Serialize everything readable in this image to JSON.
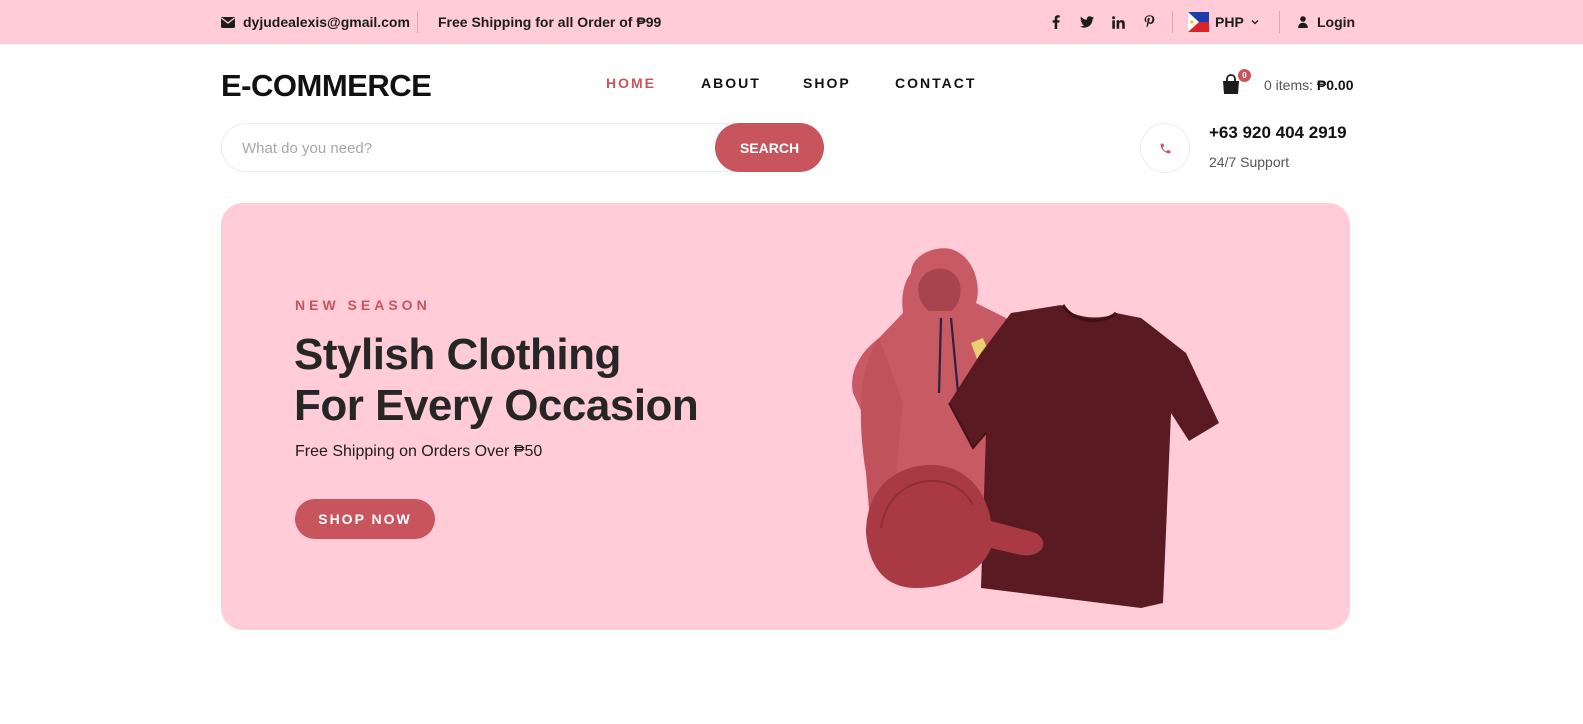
{
  "topbar": {
    "email": "dyjudealexis@gmail.com",
    "shipping_notice": "Free Shipping for all Order of ₱99",
    "social": [
      "facebook-icon",
      "twitter-icon",
      "linkedin-icon",
      "pinterest-icon"
    ],
    "currency": "PHP",
    "login_label": "Login"
  },
  "header": {
    "logo": "E-COMMERCE",
    "nav": [
      {
        "label": "HOME",
        "active": true
      },
      {
        "label": "ABOUT",
        "active": false
      },
      {
        "label": "SHOP",
        "active": false
      },
      {
        "label": "CONTACT",
        "active": false
      }
    ],
    "cart_count": "0",
    "cart_items_label": "0 items:",
    "cart_total": "₱0.00"
  },
  "search": {
    "placeholder": "What do you need?",
    "value": "",
    "button_label": "SEARCH"
  },
  "contact": {
    "phone": "+63 920 404 2919",
    "support_label": "24/7 Support"
  },
  "hero": {
    "eyebrow": "NEW SEASON",
    "title_line1": "Stylish Clothing",
    "title_line2": "For Every Occasion",
    "subtitle": "Free Shipping on Orders Over ₱50",
    "cta_label": "SHOP NOW",
    "image_items": [
      "hoodie",
      "t-shirt",
      "cap"
    ]
  },
  "colors": {
    "accent": "#c8545e",
    "pink_bg": "#ffccd8",
    "text_dark": "#1c1c1c"
  }
}
